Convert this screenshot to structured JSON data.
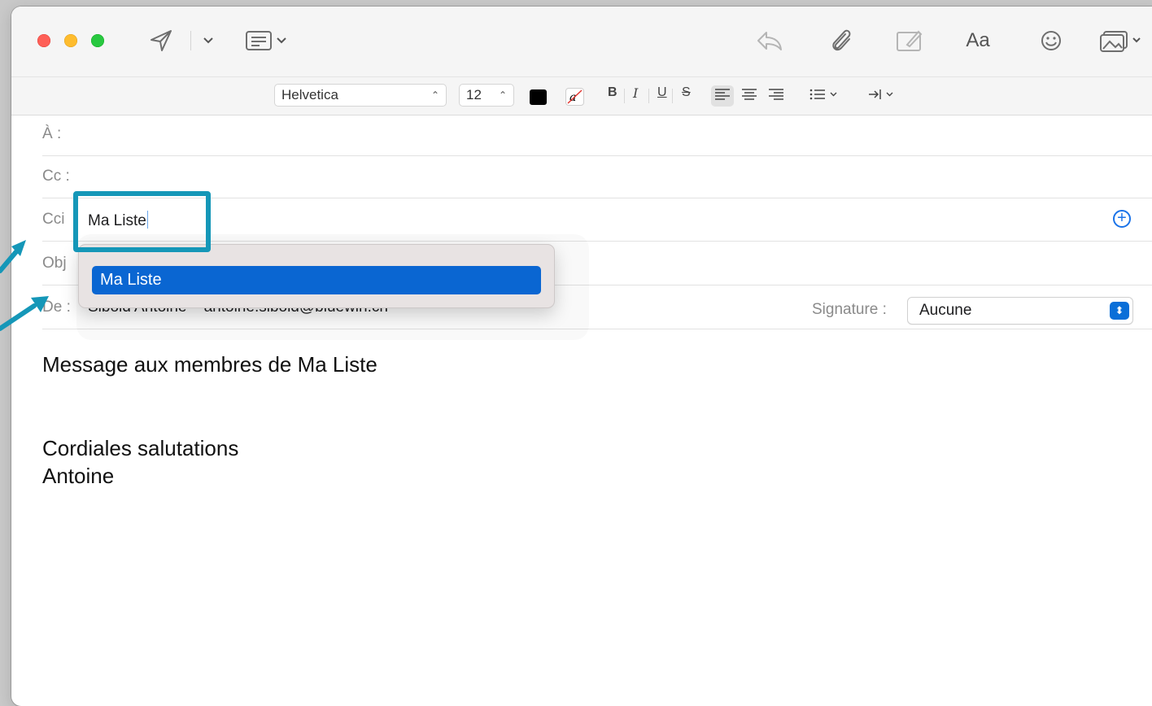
{
  "toolbar": {
    "icons": [
      "send-icon",
      "chevron-down-icon",
      "header-fields-icon",
      "reply-icon",
      "attachment-icon",
      "markup-icon",
      "emoji-icon",
      "photo-browser-icon"
    ],
    "format_label": "Aa"
  },
  "format_bar": {
    "font": "Helvetica",
    "size": "12",
    "text_color": "#000000",
    "bold": "B",
    "italic": "I",
    "underline": "U",
    "strike": "S"
  },
  "fields": {
    "to_label": "À :",
    "cc_label": "Cc :",
    "bcc_label": "Cci",
    "bcc_value": "Ma Liste",
    "subject_label": "Obj",
    "from_label": "De :",
    "from_value": "Sibold Antoine – antoine.sibold@bluewin.ch",
    "signature_label": "Signature :",
    "signature_value": "Aucune"
  },
  "autocomplete": {
    "items": [
      "Ma Liste"
    ]
  },
  "message": {
    "line1": "Message aux membres de Ma Liste",
    "line2": "Cordiales salutations",
    "line3": "Antoine"
  },
  "colors": {
    "accent": "#0a66d2",
    "annotation": "#1597b8"
  }
}
